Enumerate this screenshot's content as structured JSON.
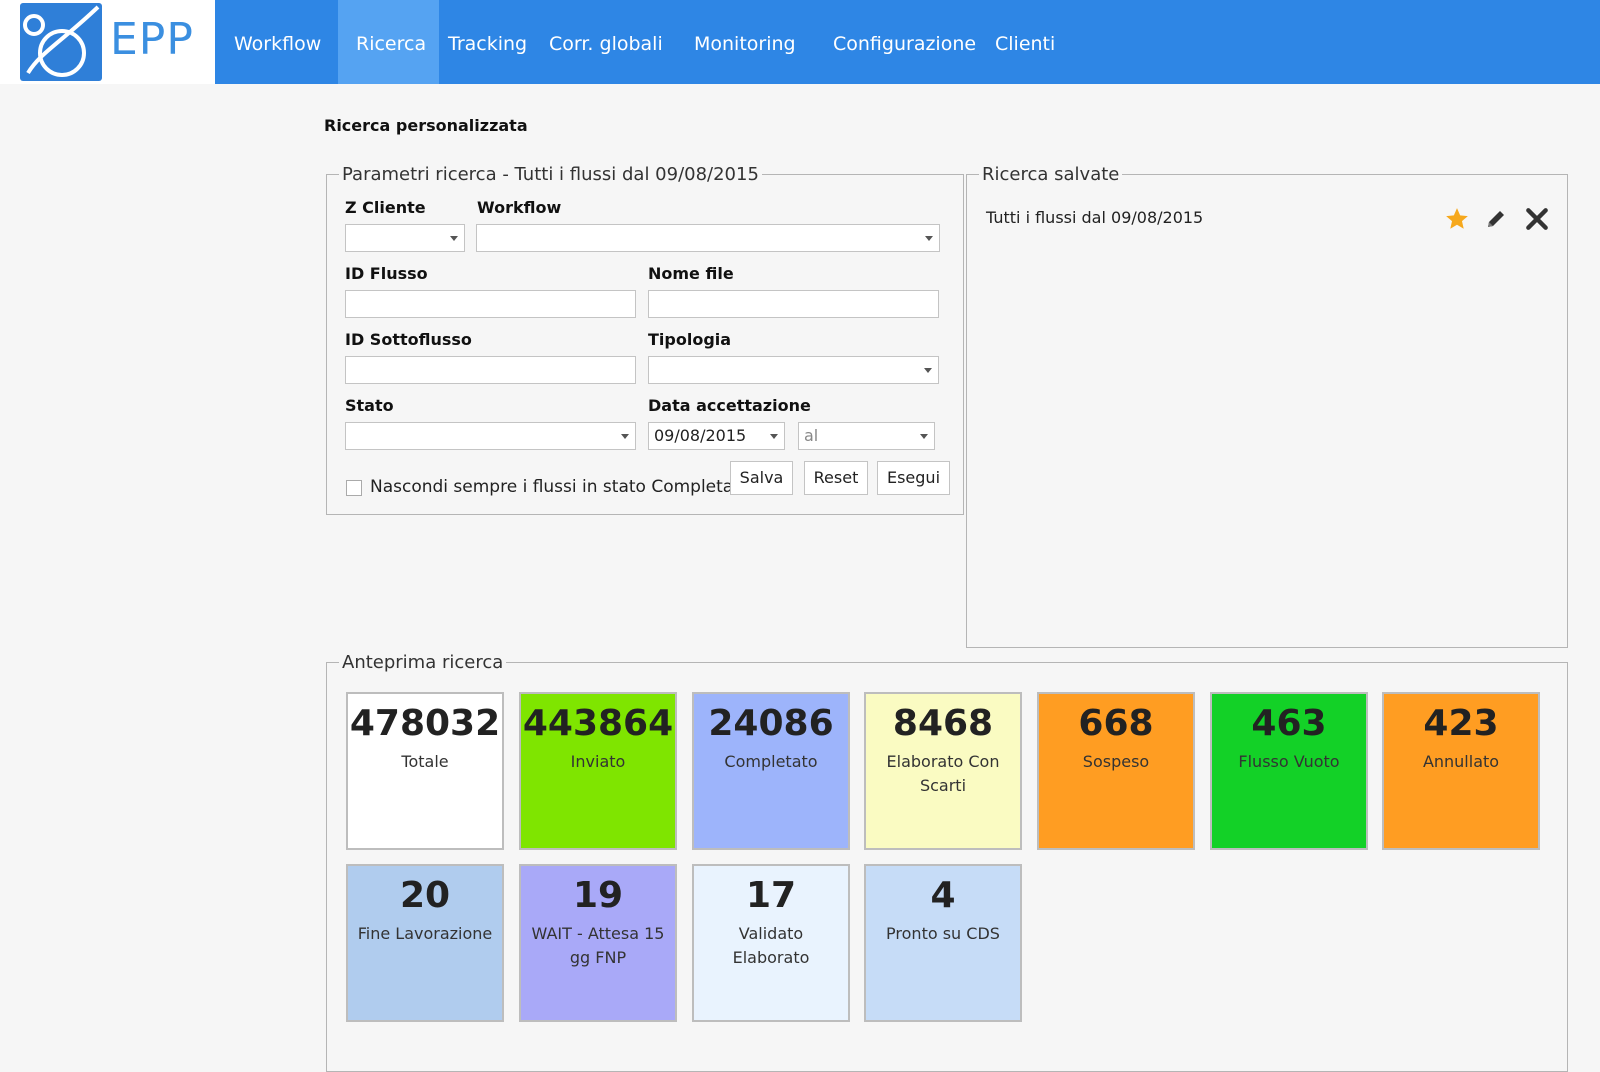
{
  "brand": {
    "logo_text": "EPP"
  },
  "nav": [
    {
      "label": "Workflow"
    },
    {
      "label": "Ricerca"
    },
    {
      "label": "Tracking"
    },
    {
      "label": "Corr. globali"
    },
    {
      "label": "Monitoring"
    },
    {
      "label": "Configurazione"
    },
    {
      "label": "Clienti"
    }
  ],
  "page": {
    "title": "Ricerca personalizzata"
  },
  "params": {
    "legend": "Parametri ricerca - Tutti i flussi dal 09/08/2015",
    "z_cliente": {
      "label": "Z Cliente",
      "value": ""
    },
    "workflow": {
      "label": "Workflow",
      "value": ""
    },
    "id_flusso": {
      "label": "ID Flusso",
      "value": ""
    },
    "nome_file": {
      "label": "Nome file",
      "value": ""
    },
    "id_sottoflusso": {
      "label": "ID Sottoflusso",
      "value": ""
    },
    "tipologia": {
      "label": "Tipologia",
      "value": ""
    },
    "stato": {
      "label": "Stato",
      "value": ""
    },
    "data_accettazione": {
      "label": "Data accettazione",
      "from": "09/08/2015",
      "to_placeholder": "al"
    },
    "hide_completed": {
      "label": "Nascondi sempre i flussi in stato Completato",
      "checked": false
    },
    "buttons": {
      "save": "Salva",
      "reset": "Reset",
      "run": "Esegui"
    }
  },
  "saved": {
    "legend": "Ricerca salvate",
    "items": [
      {
        "label": "Tutti i flussi dal 09/08/2015"
      }
    ]
  },
  "preview": {
    "legend": "Anteprima ricerca",
    "tiles": [
      {
        "count": "478032",
        "label": "Totale",
        "color": "#ffffff"
      },
      {
        "count": "443864",
        "label": "Inviato",
        "color": "#7fe500"
      },
      {
        "count": "24086",
        "label": "Completato",
        "color": "#9db4fb"
      },
      {
        "count": "8468",
        "label": "Elaborato Con Scarti",
        "color": "#fafbc2"
      },
      {
        "count": "668",
        "label": "Sospeso",
        "color": "#ff9d22"
      },
      {
        "count": "463",
        "label": "Flusso Vuoto",
        "color": "#13d127"
      },
      {
        "count": "423",
        "label": "Annullato",
        "color": "#ff9d22"
      },
      {
        "count": "20",
        "label": "Fine Lavorazione",
        "color": "#b0ccee"
      },
      {
        "count": "19",
        "label": "WAIT - Attesa 15 gg FNP",
        "color": "#a9a9f8"
      },
      {
        "count": "17",
        "label": "Validato Elaborato",
        "color": "#e9f3fe"
      },
      {
        "count": "4",
        "label": "Pronto su CDS",
        "color": "#c6dcf7"
      }
    ]
  }
}
